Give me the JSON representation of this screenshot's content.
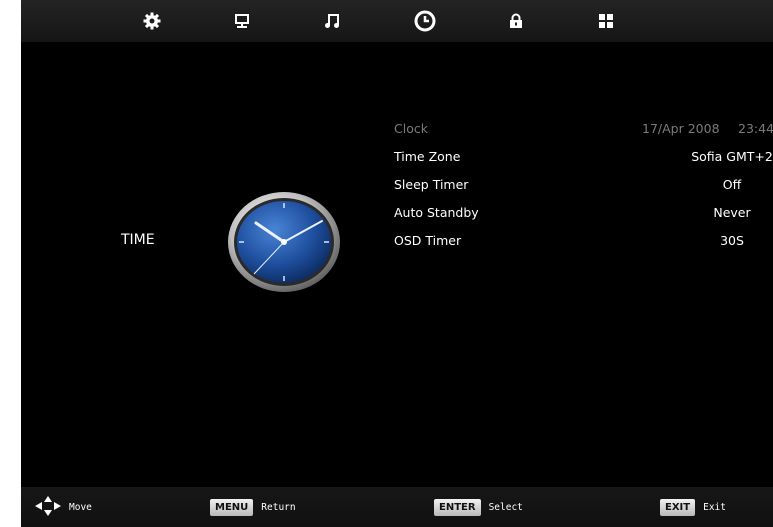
{
  "tabs": [
    {
      "name": "picture",
      "icon": "gear-icon"
    },
    {
      "name": "display",
      "icon": "monitor-icon"
    },
    {
      "name": "sound",
      "icon": "music-note-icon"
    },
    {
      "name": "time",
      "icon": "clock-icon",
      "active": true
    },
    {
      "name": "lock",
      "icon": "lock-icon"
    },
    {
      "name": "setup",
      "icon": "grid-icon"
    }
  ],
  "section": {
    "title": "TIME"
  },
  "menu": {
    "clock": {
      "label": "Clock",
      "date": "17/Apr 2008",
      "time": "23:44"
    },
    "time_zone": {
      "label": "Time Zone",
      "value": "Sofia GMT+2"
    },
    "sleep_timer": {
      "label": "Sleep Timer",
      "value": "Off"
    },
    "auto_standby": {
      "label": "Auto Standby",
      "value": "Never"
    },
    "osd_timer": {
      "label": "OSD Timer",
      "value": "30S"
    }
  },
  "footer": {
    "move": {
      "label": "Move",
      "icon": "dpad-icon"
    },
    "menu": {
      "key": "MENU",
      "label": "Return"
    },
    "enter": {
      "key": "ENTER",
      "label": "Select"
    },
    "exit": {
      "key": "EXIT",
      "label": "Exit"
    }
  },
  "colors": {
    "background": "#000000",
    "text": "#ffffff",
    "dim_text": "#7a7a7a",
    "clock_face": "#1e4f9e"
  }
}
